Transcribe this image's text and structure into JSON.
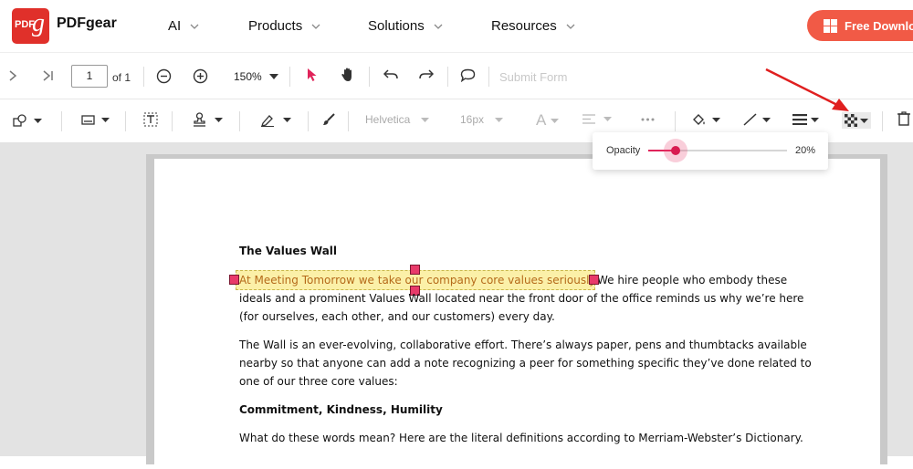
{
  "nav": {
    "logo_text": "PDF",
    "brand": "PDFgear",
    "items": [
      "AI",
      "Products",
      "Solutions",
      "Resources"
    ],
    "cta": "Free Download"
  },
  "toolbar1": {
    "page_value": "1",
    "page_total": "of 1",
    "zoom": "150%",
    "submit_form": "Submit Form"
  },
  "toolbar2": {
    "font_family": "Helvetica",
    "font_size": "16px"
  },
  "opacity_popup": {
    "label": "Opacity",
    "value_text": "20%",
    "value": 0.2
  },
  "document": {
    "heading1": "The Values Wall",
    "highlighted": "At Meeting Tomorrow we take our company core values seriously.",
    "p1_rest": " We hire people who embody these",
    "p1_l2": "ideals and a prominent Values Wall located near the front door of the office reminds us why we’re here",
    "p1_l3": "(for ourselves, each other, and our customers) every day.",
    "p2_l1": "The Wall is an ever-evolving, collaborative effort.  There’s always paper, pens and thumbtacks available",
    "p2_l2": "nearby so that anyone can add a note recognizing a peer for something specific they’ve done related to",
    "p2_l3": "one of our three core values:",
    "heading2": "Commitment, Kindness,  Humility",
    "p3_l1": "What do these words mean?  Here are the literal definitions according to Merriam-Webster’s Dictionary."
  },
  "colors": {
    "accent": "#e0245a",
    "cta": "#f15a46",
    "logo": "#e0302a",
    "highlight": "#fbf0a8"
  }
}
